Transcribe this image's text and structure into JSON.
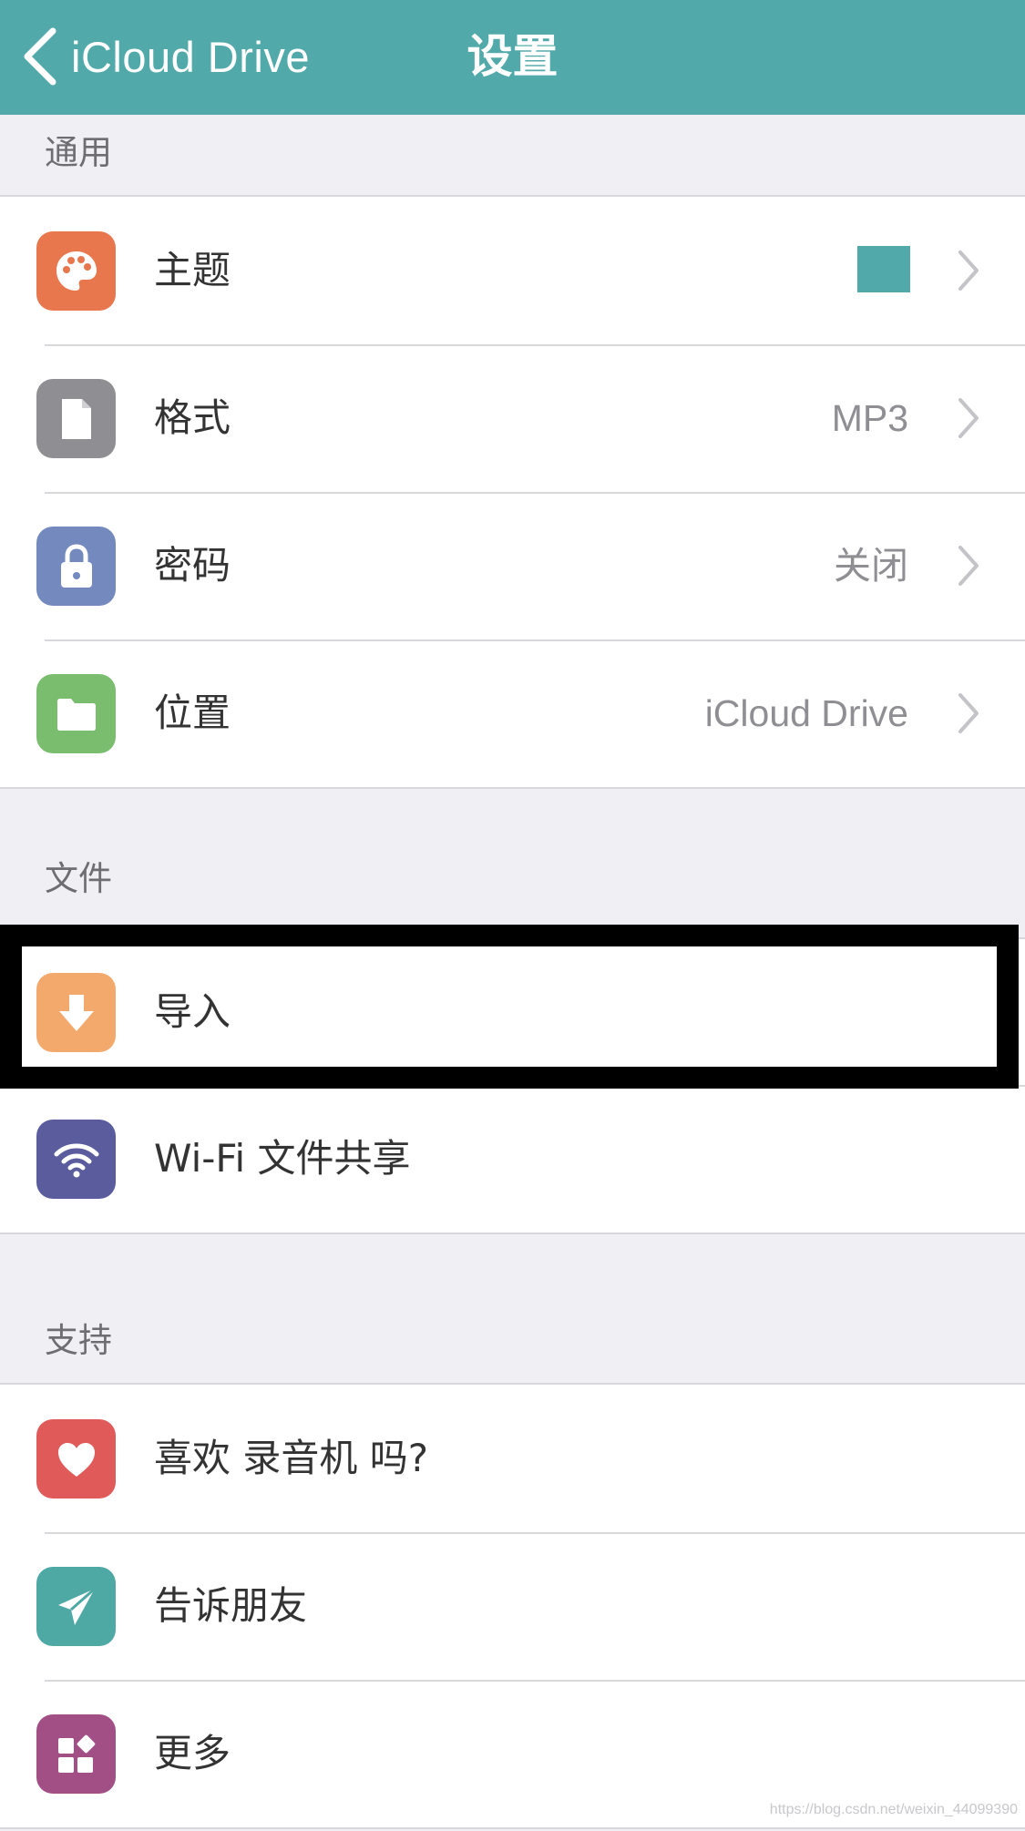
{
  "navbar": {
    "back_label": "iCloud Drive",
    "title": "设置",
    "background_color": "#52a9a9"
  },
  "sections": {
    "general": {
      "header": "通用",
      "rows": {
        "theme": {
          "label": "主题",
          "icon": "palette-icon",
          "icon_color": "#e8774e",
          "value_swatch_color": "#52a9a9"
        },
        "format": {
          "label": "格式",
          "icon": "document-icon",
          "icon_color": "#8e8e93",
          "value": "MP3"
        },
        "password": {
          "label": "密码",
          "icon": "lock-icon",
          "icon_color": "#7489bd",
          "value": "关闭"
        },
        "location": {
          "label": "位置",
          "icon": "folder-icon",
          "icon_color": "#7abd6e",
          "value": "iCloud Drive"
        }
      }
    },
    "files": {
      "header": "文件",
      "rows": {
        "import": {
          "label": "导入",
          "icon": "download-arrow-icon",
          "icon_color": "#f3a96c"
        },
        "wifi_share": {
          "label": "Wi-Fi 文件共享",
          "icon": "wifi-icon",
          "icon_color": "#5a5c9d"
        }
      }
    },
    "support": {
      "header": "支持",
      "rows": {
        "like": {
          "label": "喜欢 录音机 吗?",
          "icon": "heart-icon",
          "icon_color": "#e05a5a"
        },
        "tell_friends": {
          "label": "告诉朋友",
          "icon": "paper-plane-icon",
          "icon_color": "#4ea8a4"
        },
        "more": {
          "label": "更多",
          "icon": "apps-grid-icon",
          "icon_color": "#a24f86"
        }
      }
    }
  },
  "watermark": "https://blog.csdn.net/weixin_44099390"
}
